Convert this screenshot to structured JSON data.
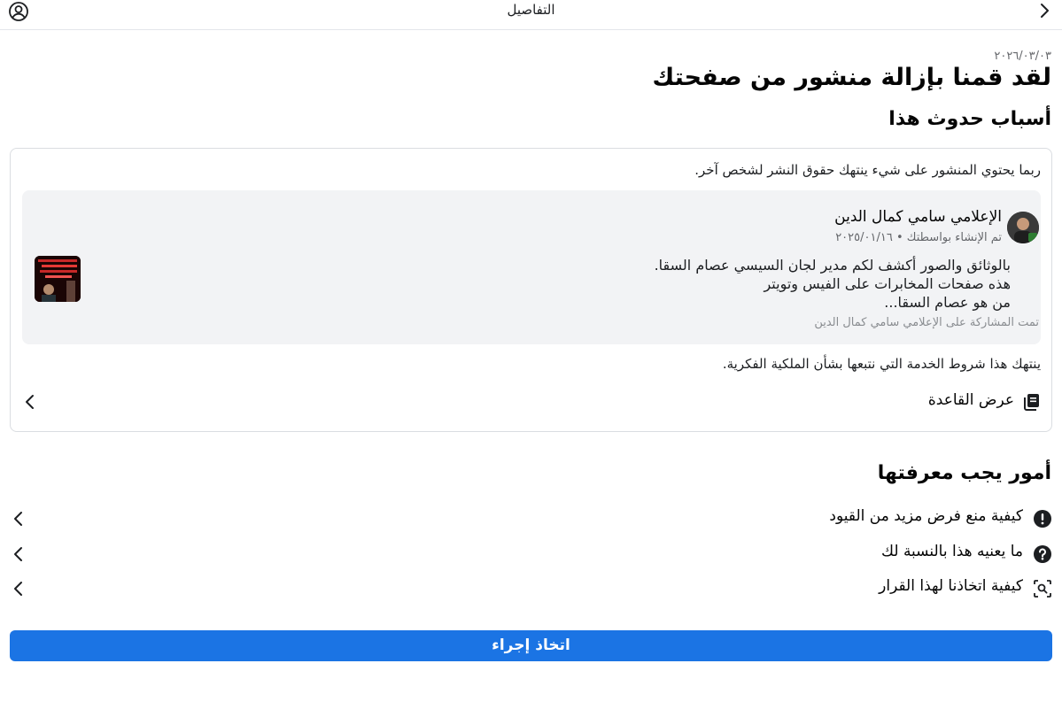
{
  "header": {
    "title": "التفاصيل"
  },
  "date": "٢٠٢٦/٠٣/٠٣",
  "headline": "لقد قمنا بإزالة منشور من صفحتك",
  "reasons_title": "أسباب حدوث هذا",
  "card": {
    "reason_text": "ربما يحتوي المنشور على شيء ينتهك حقوق النشر لشخص آخر.",
    "post": {
      "author": "الإعلامي سامي كمال الدين",
      "meta": "تم الإنشاء بواسطتك • ٢٠٢٥/٠١/١٦",
      "body_lines": [
        "بالوثائق والصور أكشف لكم مدير لجان السيسي عصام السقا.",
        "هذه صفحات المخابرات على الفيس وتويتر",
        "من هو عصام السقا..."
      ],
      "shared_by": "تمت المشاركة على الإعلامي سامي كمال الدين"
    },
    "violation_text": "ينتهك هذا شروط الخدمة التي نتبعها بشأن الملكية الفكرية.",
    "view_rule_label": "عرض القاعدة"
  },
  "things_title": "أمور يجب معرفتها",
  "things": [
    {
      "label": "كيفية منع فرض مزيد من القيود",
      "icon": "exclamation-circle-icon"
    },
    {
      "label": "ما يعنيه هذا بالنسبة لك",
      "icon": "question-circle-icon"
    },
    {
      "label": "كيفية اتخاذنا لهذا القرار",
      "icon": "scan-search-icon"
    }
  ],
  "action_label": "اتخاذ إجراء",
  "colors": {
    "accent": "#1b74e4",
    "post_bg": "#f2f3f5",
    "secondary_text": "#65676b"
  }
}
